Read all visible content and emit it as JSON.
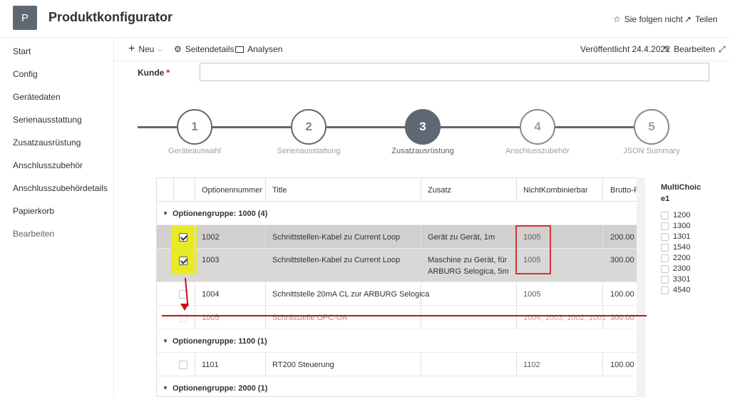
{
  "header": {
    "logo_letter": "P",
    "title": "Produktkonfigurator",
    "follow": "Sie folgen nicht",
    "share": "Teilen"
  },
  "sidebar": {
    "items": [
      {
        "label": "Start"
      },
      {
        "label": "Config"
      },
      {
        "label": "Gerätedaten"
      },
      {
        "label": "Serienausstattung"
      },
      {
        "label": "Zusatzausrüstung"
      },
      {
        "label": "Anschlusszubehör"
      },
      {
        "label": "Anschlusszubehördetails"
      },
      {
        "label": "Papierkorb"
      },
      {
        "label": "Bearbeiten"
      }
    ]
  },
  "commandbar": {
    "new": "Neu",
    "page_details": "Seitendetails",
    "analytics": "Analysen",
    "published": "Veröffentlicht 24.4.2022",
    "edit": "Bearbeiten"
  },
  "form": {
    "kunde_label": "Kunde",
    "required_mark": "*"
  },
  "stepper": {
    "steps": [
      {
        "number": "1",
        "label": "Geräteauswahl"
      },
      {
        "number": "2",
        "label": "Serienausstattung"
      },
      {
        "number": "3",
        "label": "Zusatzausrüstung"
      },
      {
        "number": "4",
        "label": "Anschlusszubehör"
      },
      {
        "number": "5",
        "label": "JSON Summary"
      }
    ]
  },
  "grid": {
    "columns": [
      "Optionennummer",
      "Title",
      "Zusatz",
      "NichtKombinierbar",
      "Brutto-P"
    ],
    "groups": [
      {
        "label": "Optionengruppe: 1000 (4)"
      },
      {
        "label": "Optionengruppe: 1100 (1)"
      },
      {
        "label": "Optionengruppe: 2000 (1)"
      }
    ],
    "rows": [
      {
        "num": "1002",
        "title": "Schnittstellen-Kabel zu Current Loop",
        "zusatz": "Gerät zu Gerät, 1m",
        "zusatz2": "",
        "nk": "1005",
        "brutto": "200.00 €"
      },
      {
        "num": "1003",
        "title": "Schnittstellen-Kabel zu Current Loop",
        "zusatz": "Maschine zu Gerät, für",
        "zusatz2": "ARBURG Selogica, 5m",
        "nk": "1005",
        "brutto": "300.00 €"
      },
      {
        "num": "1004",
        "title": "Schnittstelle 20mA CL zur ARBURG Selogica",
        "zusatz": "",
        "zusatz2": "",
        "nk": "1005",
        "brutto": "100.00 €"
      },
      {
        "num": "1005",
        "title": "Schnittstelle OPC-UA",
        "zusatz": "",
        "zusatz2": "",
        "nk": "1004, 1003, 1002, 1001",
        "brutto": "300.00 €"
      },
      {
        "num": "1101",
        "title": "RT200 Steuerung",
        "zusatz": "",
        "zusatz2": "",
        "nk": "1102",
        "brutto": "100.00 €"
      }
    ]
  },
  "multichoice": {
    "title": "MultiChoice1",
    "title_line1": "MultiChoic",
    "title_line2": "e1",
    "options": [
      "1200",
      "1300",
      "1301",
      "1540",
      "2200",
      "2300",
      "3301",
      "4540"
    ]
  },
  "colors": {
    "accent": "#5d6873",
    "highlight": "#e8ea27",
    "annotation_red": "#c50f1f"
  }
}
